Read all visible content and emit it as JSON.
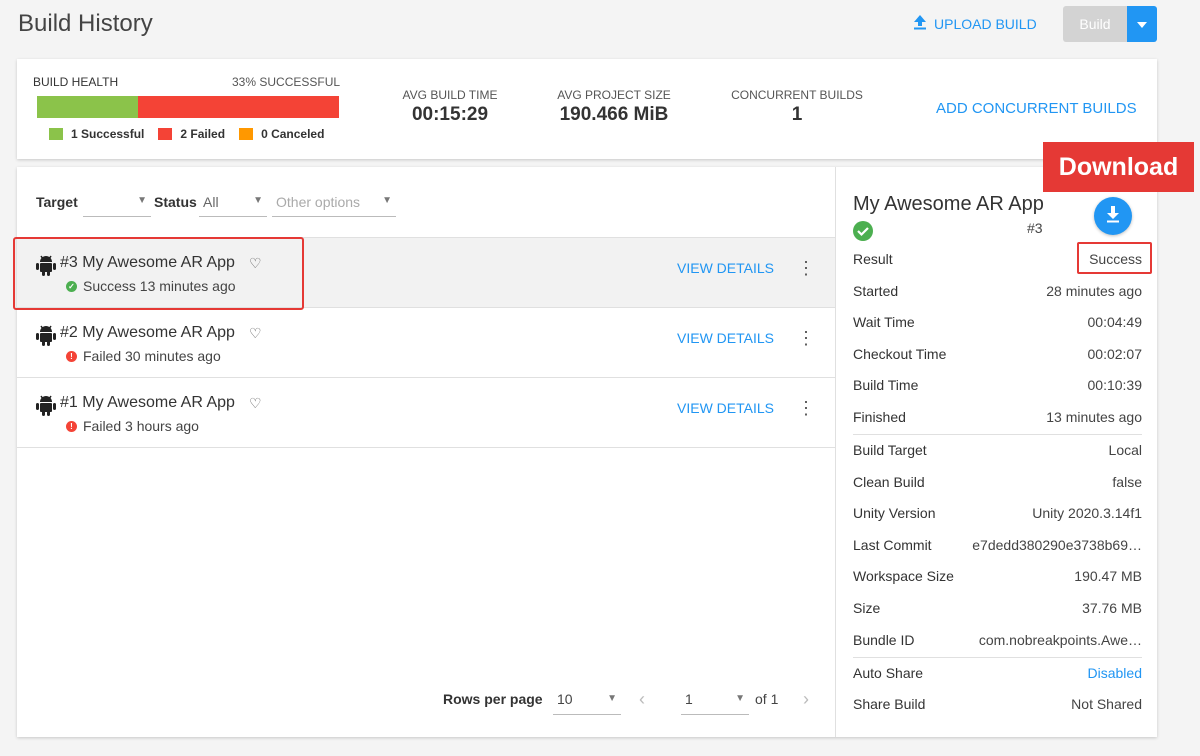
{
  "header": {
    "title": "Build History",
    "upload_label": "UPLOAD BUILD",
    "build_label": "Build"
  },
  "health": {
    "label": "BUILD HEALTH",
    "percent_label": "33% SUCCESSFUL",
    "success_fraction": 0.3333,
    "legend": [
      {
        "label": "1 Successful",
        "color": "#8bc34a"
      },
      {
        "label": "2 Failed",
        "color": "#f44336"
      },
      {
        "label": "0 Canceled",
        "color": "#ff9800"
      }
    ]
  },
  "stats": [
    {
      "label": "AVG BUILD TIME",
      "value": "00:15:29"
    },
    {
      "label": "AVG PROJECT SIZE",
      "value": "190.466 MiB"
    },
    {
      "label": "CONCURRENT BUILDS",
      "value": "1"
    }
  ],
  "add_concurrent_label": "ADD CONCURRENT BUILDS",
  "filters": {
    "target_label": "Target",
    "target_value": "",
    "status_label": "Status",
    "status_value": "All",
    "other_placeholder": "Other options"
  },
  "builds": [
    {
      "title": "#3 My Awesome AR App",
      "status": "Success 13 minutes ago",
      "state": "success",
      "action": "VIEW DETAILS"
    },
    {
      "title": "#2 My Awesome AR App",
      "status": "Failed 30 minutes ago",
      "state": "failed",
      "action": "VIEW DETAILS"
    },
    {
      "title": "#1 My Awesome AR App",
      "status": "Failed 3 hours ago",
      "state": "failed",
      "action": "VIEW DETAILS"
    }
  ],
  "pagination": {
    "rows_label": "Rows per page",
    "rows_value": "10",
    "page_value": "1",
    "of_label": "of 1"
  },
  "detail": {
    "title": "My Awesome AR App",
    "number": "#3",
    "fields": [
      {
        "label": "Result",
        "value": "Success"
      },
      {
        "label": "Started",
        "value": "28 minutes ago"
      },
      {
        "label": "Wait Time",
        "value": "00:04:49"
      },
      {
        "label": "Checkout Time",
        "value": "00:02:07"
      },
      {
        "label": "Build Time",
        "value": "00:10:39"
      },
      {
        "label": "Finished",
        "value": "13 minutes ago"
      },
      {
        "label": "Build Target",
        "value": "Local"
      },
      {
        "label": "Clean Build",
        "value": "false"
      },
      {
        "label": "Unity Version",
        "value": "Unity 2020.3.14f1"
      },
      {
        "label": "Last Commit",
        "value": "e7dedd380290e3738b69…"
      },
      {
        "label": "Workspace Size",
        "value": "190.47 MB"
      },
      {
        "label": "Size",
        "value": "37.76 MB"
      },
      {
        "label": "Bundle ID",
        "value": "com.nobreakpoints.Awe…"
      },
      {
        "label": "Auto Share",
        "value": "Disabled"
      },
      {
        "label": "Share Build",
        "value": "Not Shared"
      }
    ]
  },
  "callout": {
    "label": "Download"
  },
  "colors": {
    "accent": "#2196f3",
    "success": "#4caf50",
    "failed": "#f44336",
    "highlight": "#e53935"
  }
}
